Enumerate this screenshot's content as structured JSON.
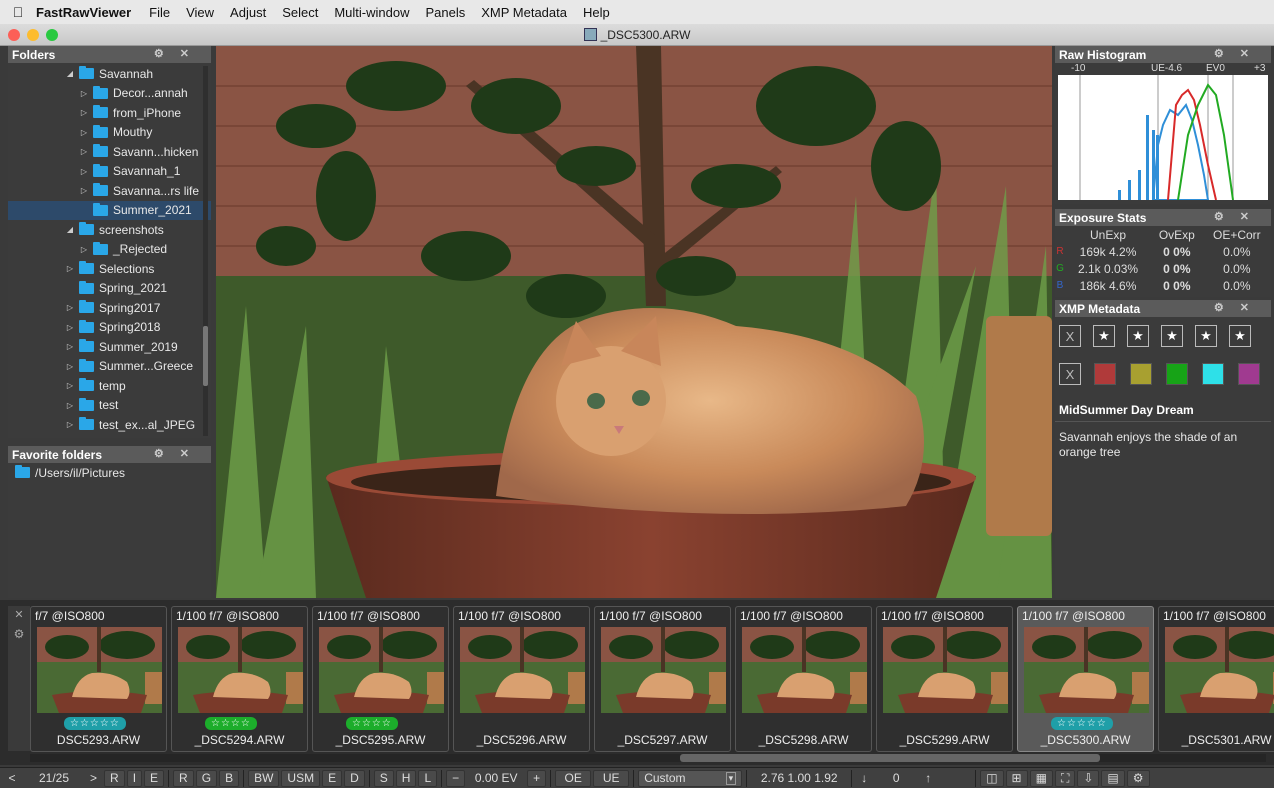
{
  "menubar": {
    "app_name": "FastRawViewer",
    "items": [
      "File",
      "View",
      "Adjust",
      "Select",
      "Multi-window",
      "Panels",
      "XMP Metadata",
      "Help"
    ]
  },
  "window": {
    "title": "_DSC5300.ARW"
  },
  "folders_panel": {
    "title": "Folders",
    "items": [
      {
        "label": "Savannah",
        "indent": 0,
        "twisty": "open"
      },
      {
        "label": "Decor...annah",
        "indent": 1,
        "twisty": "closed"
      },
      {
        "label": "from_iPhone",
        "indent": 1,
        "twisty": "closed"
      },
      {
        "label": "Mouthy",
        "indent": 1,
        "twisty": "closed"
      },
      {
        "label": "Savann...hicken",
        "indent": 1,
        "twisty": "closed"
      },
      {
        "label": "Savannah_1",
        "indent": 1,
        "twisty": "closed"
      },
      {
        "label": "Savanna...rs life",
        "indent": 1,
        "twisty": "closed"
      },
      {
        "label": "Summer_2021",
        "indent": 1,
        "twisty": "none",
        "selected": true
      },
      {
        "label": "screenshots",
        "indent": 0,
        "twisty": "open"
      },
      {
        "label": "_Rejected",
        "indent": 1,
        "twisty": "closed"
      },
      {
        "label": "Selections",
        "indent": 0,
        "twisty": "closed"
      },
      {
        "label": "Spring_2021",
        "indent": 0,
        "twisty": "none"
      },
      {
        "label": "Spring2017",
        "indent": 0,
        "twisty": "closed"
      },
      {
        "label": "Spring2018",
        "indent": 0,
        "twisty": "closed"
      },
      {
        "label": "Summer_2019",
        "indent": 0,
        "twisty": "closed"
      },
      {
        "label": "Summer...Greece",
        "indent": 0,
        "twisty": "closed"
      },
      {
        "label": "temp",
        "indent": 0,
        "twisty": "closed"
      },
      {
        "label": "test",
        "indent": 0,
        "twisty": "closed"
      },
      {
        "label": "test_ex...al_JPEG",
        "indent": 0,
        "twisty": "closed"
      }
    ]
  },
  "favorites_panel": {
    "title": "Favorite folders",
    "items": [
      {
        "label": "/Users/il/Pictures"
      }
    ]
  },
  "histogram_panel": {
    "title": "Raw Histogram",
    "scale_labels": [
      "-10",
      "UE-4.6",
      "EV0",
      "+3"
    ]
  },
  "exposure_panel": {
    "title": "Exposure Stats",
    "headers": [
      "UnExp",
      "OvExp",
      "OE+Corr"
    ],
    "rows": [
      {
        "channel": "R",
        "color": "#c33",
        "unexp": "169k 4.2%",
        "ovexp": "0 0%",
        "oecorr": "0.0%"
      },
      {
        "channel": "G",
        "color": "#2a2",
        "unexp": "2.1k 0.03%",
        "ovexp": "0 0%",
        "oecorr": "0.0%"
      },
      {
        "channel": "B",
        "color": "#36c",
        "unexp": "186k 4.6%",
        "ovexp": "0 0%",
        "oecorr": "0.0%"
      }
    ]
  },
  "xmp_panel": {
    "title": "XMP Metadata",
    "reject_symbol": "X",
    "star_symbol": "★",
    "color_labels": [
      "#b03a3a",
      "#a8a030",
      "#17a317",
      "#2ee0e8",
      "#a03a90"
    ],
    "headline": "MidSummer Day Dream",
    "description": "Savannah enjoys the shade of an orange tree"
  },
  "filmstrip": {
    "thumbs": [
      {
        "exif": "f/7  @ISO800",
        "rating": "☆☆☆☆☆",
        "rating_color": "#1f9fa8",
        "filename": "DSC5293.ARW",
        "selected": false
      },
      {
        "exif": "1/100 f/7  @ISO800",
        "rating": "☆☆☆☆",
        "rating_color": "#1cad2b",
        "filename": "_DSC5294.ARW",
        "selected": false
      },
      {
        "exif": "1/100 f/7  @ISO800",
        "rating": "☆☆☆☆",
        "rating_color": "#1cad2b",
        "filename": "_DSC5295.ARW",
        "selected": false
      },
      {
        "exif": "1/100 f/7  @ISO800",
        "rating": "",
        "rating_color": "",
        "filename": "_DSC5296.ARW",
        "selected": false
      },
      {
        "exif": "1/100 f/7  @ISO800",
        "rating": "",
        "rating_color": "",
        "filename": "_DSC5297.ARW",
        "selected": false
      },
      {
        "exif": "1/100 f/7  @ISO800",
        "rating": "",
        "rating_color": "",
        "filename": "_DSC5298.ARW",
        "selected": false
      },
      {
        "exif": "1/100 f/7  @ISO800",
        "rating": "",
        "rating_color": "",
        "filename": "_DSC5299.ARW",
        "selected": false
      },
      {
        "exif": "1/100 f/7  @ISO800",
        "rating": "☆☆☆☆☆",
        "rating_color": "#1f9fa8",
        "filename": "_DSC5300.ARW",
        "selected": true
      },
      {
        "exif": "1/100 f/7  @ISO800",
        "rating": "",
        "rating_color": "",
        "filename": "_DSC5301.ARW",
        "selected": false
      }
    ]
  },
  "statusbar": {
    "prev": "<",
    "counter": "21/25",
    "next": ">",
    "channel_buttons": [
      "R",
      "I",
      "E",
      "R",
      "G",
      "B",
      "BW",
      "USM",
      "E",
      "D",
      "S",
      "H",
      "L"
    ],
    "minus": "−",
    "ev_value": "0.00 EV",
    "plus": "+",
    "oe": "OE",
    "ue": "UE",
    "profile": "Custom",
    "wb_values": "2.76 1.00 1.92",
    "rotate_value": "0",
    "down_arrow": "↓",
    "up_arrow": "↑"
  }
}
